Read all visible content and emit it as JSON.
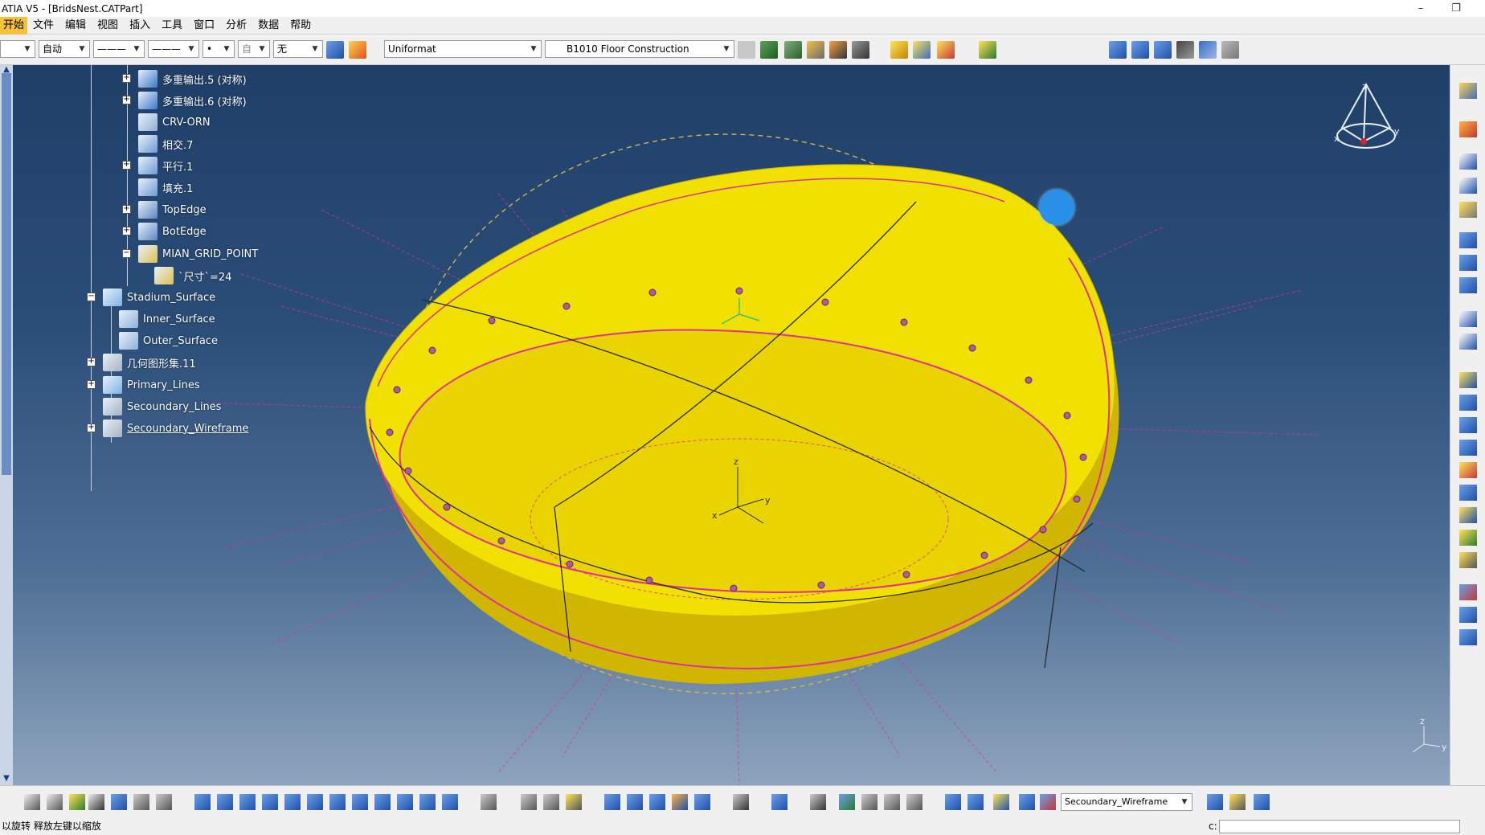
{
  "window": {
    "title": "ATIA V5 - [BridsNest.CATPart]",
    "minimize_glyph": "–",
    "restore_glyph": "❐"
  },
  "menu": [
    "开始",
    "文件",
    "编辑",
    "视图",
    "插入",
    "工具",
    "窗口",
    "分析",
    "数据",
    "帮助"
  ],
  "toolbar": {
    "combo_layer": "",
    "combo_auto": "自动",
    "combo_line_type": "———",
    "combo_line_weight": "———",
    "combo_dot": "•",
    "combo_auto2": "自",
    "combo_none": "无",
    "combo_material_preset": "Uniformat",
    "combo_material": "B1010 Floor Construction"
  },
  "tree": [
    {
      "label": "多重输出.5 (对称)",
      "icon": "multi-output-icon",
      "expander": "+",
      "tone": "#3a78c9"
    },
    {
      "label": "多重输出.6 (对称)",
      "icon": "multi-output-icon",
      "expander": "+",
      "tone": "#3a78c9"
    },
    {
      "label": "CRV-ORN",
      "icon": "formula-icon",
      "expander": "",
      "tone": "#8fb0d6"
    },
    {
      "label": "相交.7",
      "icon": "intersect-icon",
      "expander": "",
      "tone": "#6c9bd3"
    },
    {
      "label": "平行.1",
      "icon": "parallel-icon",
      "expander": "+",
      "tone": "#6c9bd3"
    },
    {
      "label": "填充.1",
      "icon": "fill-icon",
      "expander": "",
      "tone": "#6c9bd3"
    },
    {
      "label": "TopEdge",
      "icon": "edge-icon",
      "expander": "+",
      "tone": "#5b86c2"
    },
    {
      "label": "BotEdge",
      "icon": "edge-icon",
      "expander": "+",
      "tone": "#5b86c2"
    },
    {
      "label": "MIAN_GRID_POINT",
      "icon": "grid-point-icon",
      "expander": "−",
      "tone": "#e0c050"
    },
    {
      "label": "`尺寸`=24",
      "icon": "parameter-icon",
      "expander": "",
      "tone": "#e0c050"
    },
    {
      "label": "Stadium_Surface",
      "icon": "geometric-set-icon",
      "expander": "−",
      "tone": "#7fb3e6"
    },
    {
      "label": "Inner_Surface",
      "icon": "formula-icon",
      "expander": "",
      "tone": "#8fb0d6"
    },
    {
      "label": "Outer_Surface",
      "icon": "formula-icon",
      "expander": "",
      "tone": "#8fb0d6"
    },
    {
      "label": "几何图形集.11",
      "icon": "geometric-set-icon",
      "expander": "+",
      "tone": "#a6b3c3"
    },
    {
      "label": "Primary_Lines",
      "icon": "geometric-set-icon",
      "expander": "+",
      "tone": "#7fb3e6"
    },
    {
      "label": "Secoundary_Lines",
      "icon": "geometric-set-icon",
      "expander": "",
      "tone": "#a6b3c3"
    },
    {
      "label": "Secoundary_Wireframe",
      "icon": "geometric-set-icon",
      "expander": "+",
      "tone": "#a6b3c3"
    }
  ],
  "compass": {
    "x": "x",
    "y": "y",
    "z": "z"
  },
  "model_axes": {
    "x": "x",
    "y": "y",
    "z": "z"
  },
  "corner_axes": {
    "y": "y",
    "z": "z"
  },
  "bottom_toolbar": {
    "layer_select": "Secoundary_Wireframe"
  },
  "status": {
    "message": "以旋转 释放左键以缩放",
    "command_label": "c:"
  },
  "colors": {
    "viewport_top": "#1f3f68",
    "viewport_bottom": "#8ea4bd",
    "surface_yellow": "#f1e000",
    "wire_magenta": "#e0309a",
    "point_blue": "#2a8fe6"
  }
}
